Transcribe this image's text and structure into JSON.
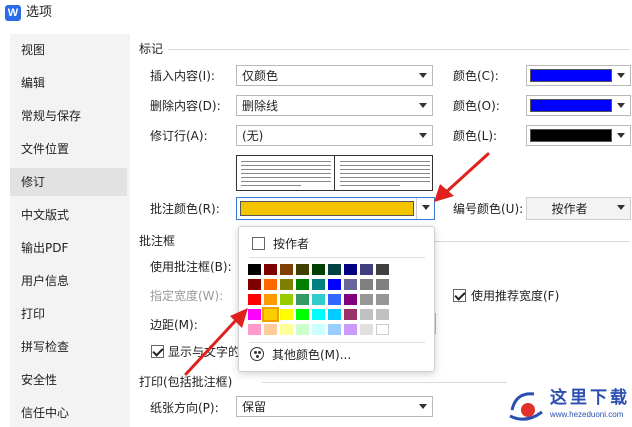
{
  "window": {
    "title": "选项",
    "app_icon_letter": "W"
  },
  "sidebar": {
    "items": [
      {
        "label": "视图"
      },
      {
        "label": "编辑"
      },
      {
        "label": "常规与保存"
      },
      {
        "label": "文件位置"
      },
      {
        "label": "修订",
        "active": true
      },
      {
        "label": "中文版式"
      },
      {
        "label": "输出PDF"
      },
      {
        "label": "用户信息"
      },
      {
        "label": "打印"
      },
      {
        "label": "拼写检查"
      },
      {
        "label": "安全性"
      },
      {
        "label": "信任中心"
      }
    ]
  },
  "marks": {
    "section_title": "标记",
    "insert": {
      "label": "插入内容(I):",
      "value": "仅颜色",
      "color_label": "颜色(C):",
      "color": "#0000ff"
    },
    "delete": {
      "label": "删除内容(D):",
      "value": "删除线",
      "color_label": "颜色(O):",
      "color": "#0000ff"
    },
    "revision_line": {
      "label": "修订行(A):",
      "value": "(无)",
      "color_label": "颜色(L):",
      "color": "#000000"
    },
    "comment_color": {
      "label": "批注颜色(R):",
      "color": "#f5c400"
    },
    "number_color": {
      "label": "编号颜色(U):",
      "value": "按作者"
    }
  },
  "balloon": {
    "section_title": "批注框",
    "use_balloon_label": "使用批注框(B):",
    "preferred_width_label": "指定宽度(W):",
    "use_recommended_width_label": "使用推荐宽度(F)",
    "use_recommended_width_checked": true,
    "margin_label": "边距(M):",
    "show_lines_label": "显示与文字的",
    "show_lines_checked": true
  },
  "print": {
    "section_title": "打印(包括批注框)",
    "orientation_label": "纸张方向(P):",
    "orientation_value": "保留"
  },
  "color_popup": {
    "by_author_label": "按作者",
    "by_author_checked": false,
    "more_colors_label": "其他颜色(M)...",
    "grid": [
      [
        "#000000",
        "#7f0000",
        "#7f3f00",
        "#3f3f00",
        "#004000",
        "#004040",
        "#000080",
        "#3f3f7f",
        "#404040"
      ],
      [
        "#800000",
        "#ff6600",
        "#808000",
        "#008000",
        "#008080",
        "#0000ff",
        "#666699",
        "#808080",
        "#808080"
      ],
      [
        "#ff0000",
        "#ff9900",
        "#99cc00",
        "#339966",
        "#33cccc",
        "#3366ff",
        "#800080",
        "#969696",
        "#969696"
      ],
      [
        "#ff00ff",
        "#ffcc00",
        "#ffff00",
        "#00ff00",
        "#00ffff",
        "#00ccff",
        "#993366",
        "#c0c0c0",
        "#c0c0c0"
      ],
      [
        "#ff99cc",
        "#ffcc99",
        "#ffff99",
        "#ccffcc",
        "#ccffff",
        "#99ccff",
        "#cc99ff",
        "#e0e0e0",
        "#ffffff"
      ]
    ],
    "selected_row": 3,
    "selected_col": 1
  },
  "watermark": {
    "text": "这里下载",
    "subtext": "www.hezeduoni.com"
  }
}
